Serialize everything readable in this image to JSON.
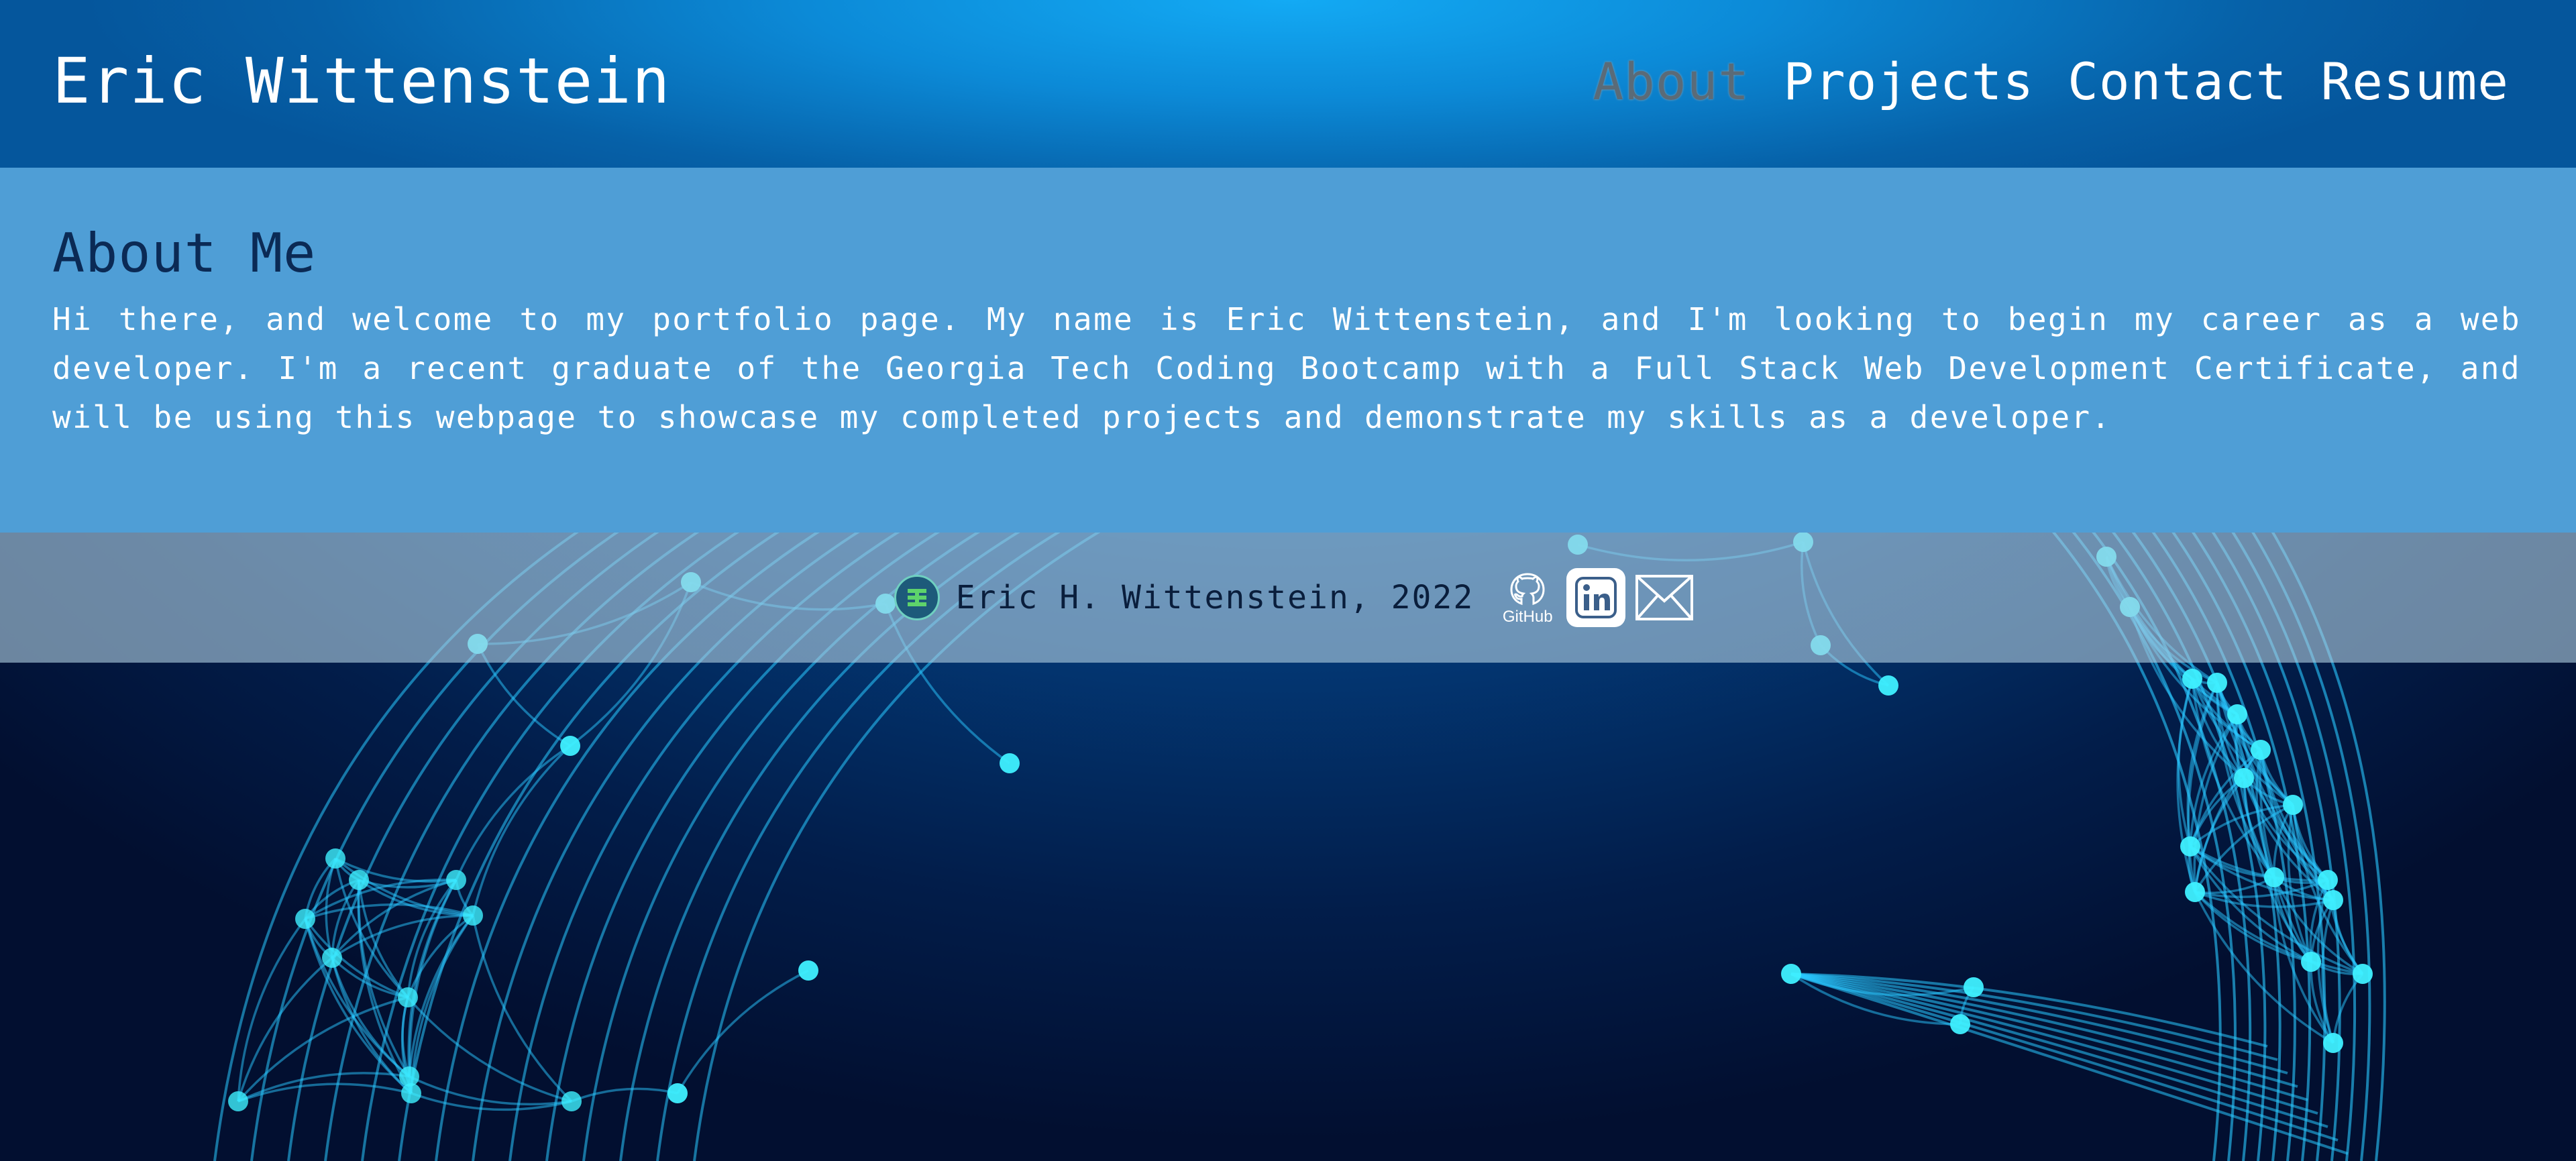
{
  "header": {
    "title": "Eric Wittenstein",
    "nav": [
      {
        "label": "About",
        "active": true
      },
      {
        "label": "Projects",
        "active": false
      },
      {
        "label": "Contact",
        "active": false
      },
      {
        "label": "Resume",
        "active": false
      }
    ]
  },
  "about": {
    "heading": "About Me",
    "body": "Hi there, and welcome to my portfolio page. My name is Eric Wittenstein, and I'm looking to begin my career as a web developer. I'm a recent graduate of the Georgia Tech Coding Bootcamp with a Full Stack Web Development Certificate, and will be using this webpage to showcase my completed projects and demonstrate my skills as a developer."
  },
  "footer": {
    "logo_icon": "ew-logo-icon",
    "copyright": "Eric H. Wittenstein, 2022",
    "social": [
      {
        "icon": "github-icon",
        "label": "GitHub"
      },
      {
        "icon": "linkedin-icon",
        "label": "in"
      },
      {
        "icon": "email-icon"
      }
    ]
  },
  "colors": {
    "header_bg": "#0c8ad7",
    "about_bg": "#4f9ed6",
    "heading": "#0b2a55",
    "active_nav": "#5a6b78",
    "network_line": "#29c8ff",
    "network_node": "#3ff0ff"
  }
}
